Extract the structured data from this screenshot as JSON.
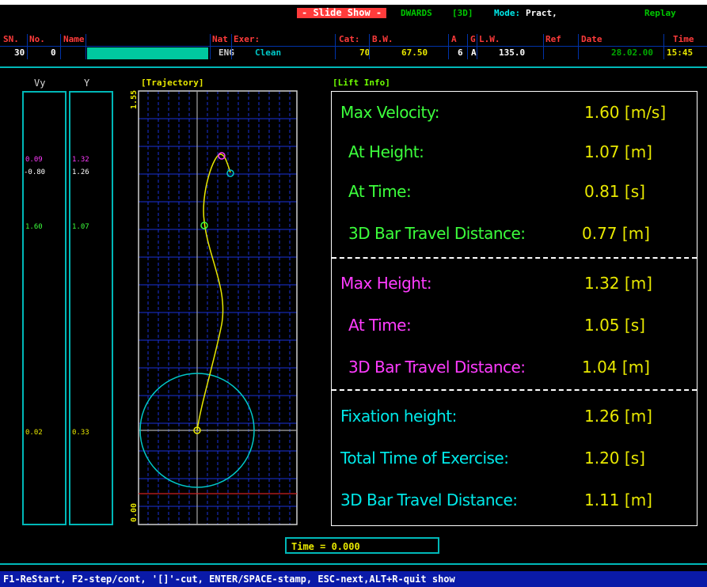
{
  "topbar": {
    "slideshow_label": "- Slide Show -",
    "athlete": "DWARDS",
    "dim": "[3D]",
    "mode_label": "Mode:",
    "mode_value": "Pract,",
    "replay": "Replay"
  },
  "header": {
    "labels": {
      "sn": "SN.",
      "no": "No.",
      "name": "Name",
      "nat": "Nat",
      "exer": "Exer:",
      "cat": "Cat:",
      "bw": "B.W.",
      "a": "A",
      "g": "G",
      "lw": "L.W.",
      "ref": "Ref",
      "date": "Date",
      "time": "Time"
    },
    "values": {
      "sn": "30",
      "no": "0",
      "name": "",
      "nat": "ENG",
      "exer": "Clean",
      "cat": "70",
      "bw": "67.50",
      "a": "6",
      "g": "A",
      "lw": "135.0",
      "ref": "",
      "date": "28.02.00",
      "time": "15:45"
    }
  },
  "columns": {
    "vy_label": "Vy",
    "y_label": "Y",
    "vy_values": [
      "0.09",
      "-0.80",
      "1.60",
      "0.02"
    ],
    "y_values": [
      "1.32",
      "1.26",
      "1.07",
      "0.33"
    ]
  },
  "trajectory": {
    "title": "[Trajectory]",
    "axis_top": "1.55",
    "axis_bottom": "0.00"
  },
  "lift_info": {
    "title": "[Lift Info]",
    "rows": [
      {
        "label": "Max Velocity:",
        "value": "1.60",
        "unit": "[m/s]",
        "color": "#3cff3c"
      },
      {
        "label": "At Height:",
        "value": "1.07",
        "unit": "[m]",
        "color": "#3cff3c"
      },
      {
        "label": "At Time:",
        "value": "0.81",
        "unit": "[s]",
        "color": "#3cff3c"
      },
      {
        "label": "3D Bar Travel Distance:",
        "value": "0.77",
        "unit": "[m]",
        "color": "#3cff3c"
      },
      {
        "label": "Max Height:",
        "value": "1.32",
        "unit": "[m]",
        "color": "#ff3cff"
      },
      {
        "label": "At Time:",
        "value": "1.05",
        "unit": "[s]",
        "color": "#ff3cff"
      },
      {
        "label": "3D Bar Travel Distance:",
        "value": "1.04",
        "unit": "[m]",
        "color": "#ff3cff"
      },
      {
        "label": "Fixation height:",
        "value": "1.26",
        "unit": "[m]",
        "color": "#00e8e8"
      },
      {
        "label": "Total Time of Exercise:",
        "value": "1.20",
        "unit": "[s]",
        "color": "#00e8e8"
      },
      {
        "label": "3D Bar Travel Distance:",
        "value": "1.11",
        "unit": "[m]",
        "color": "#00e8e8"
      }
    ]
  },
  "time_display": "Time = 0.000",
  "footer": "F1-ReStart, F2-step/cont, '[]'-cut, ENTER/SPACE-stamp, ESC-next,ALT+R-quit show"
}
